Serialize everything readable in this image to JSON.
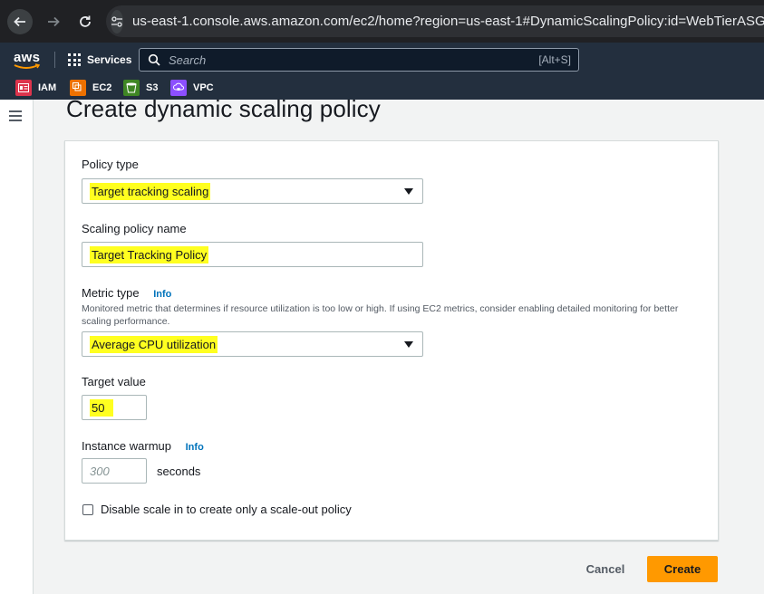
{
  "browser": {
    "url": "us-east-1.console.aws.amazon.com/ec2/home?region=us-east-1#DynamicScalingPolicy:id=WebTierASG"
  },
  "aws_nav": {
    "logo": "aws",
    "services_label": "Services",
    "search_placeholder": "Search",
    "search_shortcut": "[Alt+S]"
  },
  "favorites": [
    {
      "label": "IAM",
      "icon": "iam-icon",
      "color": "#dd344c"
    },
    {
      "label": "EC2",
      "icon": "ec2-icon",
      "color": "#ed7100"
    },
    {
      "label": "S3",
      "icon": "s3-icon",
      "color": "#3f8624"
    },
    {
      "label": "VPC",
      "icon": "vpc-icon",
      "color": "#8c4fff"
    }
  ],
  "page": {
    "title": "Create dynamic scaling policy"
  },
  "form": {
    "policy_type_label": "Policy type",
    "policy_type_value": "Target tracking scaling",
    "policy_name_label": "Scaling policy name",
    "policy_name_value": "Target Tracking Policy",
    "metric_type_label": "Metric type",
    "metric_info": "Info",
    "metric_description": "Monitored metric that determines if resource utilization is too low or high. If using EC2 metrics, consider enabling detailed monitoring for better scaling performance.",
    "metric_type_value": "Average CPU utilization",
    "target_value_label": "Target value",
    "target_value": "50",
    "warmup_label": "Instance warmup",
    "warmup_info": "Info",
    "warmup_placeholder": "300",
    "warmup_unit": "seconds",
    "disable_scale_in_label": "Disable scale in to create only a scale-out policy"
  },
  "actions": {
    "cancel": "Cancel",
    "create": "Create"
  },
  "colors": {
    "highlight": "#ffff20",
    "primary_button": "#ff9900",
    "link": "#0073bb",
    "aws_nav": "#232f3e"
  }
}
